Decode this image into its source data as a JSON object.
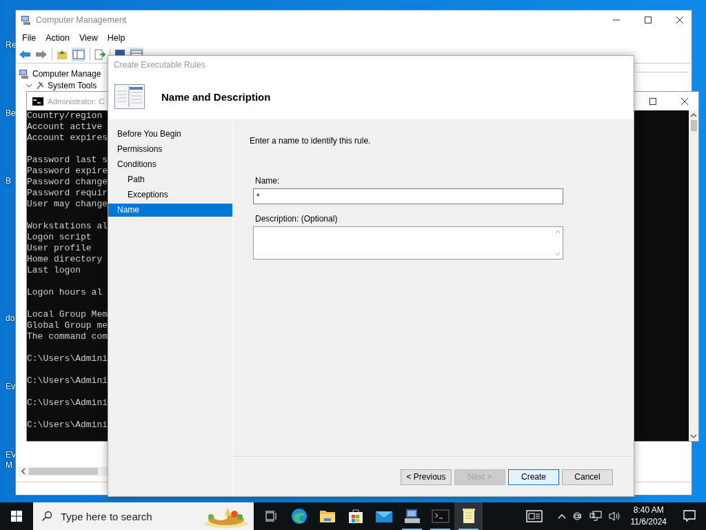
{
  "desktop": {
    "icon_labels": [
      {
        "text": "Re"
      },
      {
        "text": "Be"
      },
      {
        "text": "B"
      },
      {
        "text": "do"
      },
      {
        "text": "Ev"
      },
      {
        "text": "EV"
      },
      {
        "text": "M"
      }
    ]
  },
  "computer_management": {
    "title": "Computer Management",
    "menu": [
      "File",
      "Action",
      "View",
      "Help"
    ],
    "tree": [
      {
        "label": "Computer Manage",
        "children": [
          {
            "label": "System Tools",
            "expanded": true
          }
        ]
      }
    ]
  },
  "console": {
    "title": "Administrator: C",
    "blocks": [
      [
        "Country/region",
        "Account active",
        "Account expires"
      ],
      [
        "Password last s",
        "Password expire",
        "Password change",
        "Password requir",
        "User may change"
      ],
      [
        "Workstations al",
        "Logon script",
        "User profile",
        "Home directory",
        "Last logon"
      ],
      [
        "Logon hours al"
      ],
      [
        "Local Group Mem",
        "Global Group me",
        "The command com"
      ],
      [
        "C:\\Users\\Admini"
      ],
      [
        "C:\\Users\\Admini"
      ],
      [
        "C:\\Users\\Admini"
      ],
      [
        "C:\\Users\\Admini"
      ]
    ]
  },
  "wizard": {
    "title": "Create Executable Rules",
    "heading": "Name and Description",
    "steps": [
      {
        "label": "Before You Begin",
        "selected": false
      },
      {
        "label": "Permissions",
        "selected": false
      },
      {
        "label": "Conditions",
        "selected": false,
        "children": [
          {
            "label": "Path",
            "selected": false
          },
          {
            "label": "Exceptions",
            "selected": false
          }
        ]
      },
      {
        "label": "Name",
        "selected": true
      }
    ],
    "instruction": "Enter a name to identify this rule.",
    "name_field": {
      "label": "Name:",
      "value": "*"
    },
    "description_field": {
      "label": "Description: (Optional)"
    },
    "buttons": [
      {
        "label": "< Previous",
        "disabled": false,
        "default": false
      },
      {
        "label": "Next >",
        "disabled": true,
        "default": false
      },
      {
        "label": "Create",
        "disabled": false,
        "default": true
      },
      {
        "label": "Cancel",
        "disabled": false,
        "default": false
      }
    ]
  },
  "taskbar": {
    "search": {
      "placeholder": "Type here to search"
    },
    "apps": [
      {
        "kind": "taskview",
        "running": false,
        "active": false
      },
      {
        "kind": "browser",
        "running": false,
        "active": false
      },
      {
        "kind": "folder",
        "running": false,
        "active": false
      },
      {
        "kind": "store",
        "running": false,
        "active": false
      },
      {
        "kind": "mail",
        "running": false,
        "active": false
      },
      {
        "kind": "computer",
        "running": true,
        "active": false
      },
      {
        "kind": "terminal",
        "running": true,
        "active": false
      },
      {
        "kind": "notepad",
        "running": true,
        "active": true
      }
    ],
    "time": "8:40 AM",
    "date": "11/6/2024"
  }
}
